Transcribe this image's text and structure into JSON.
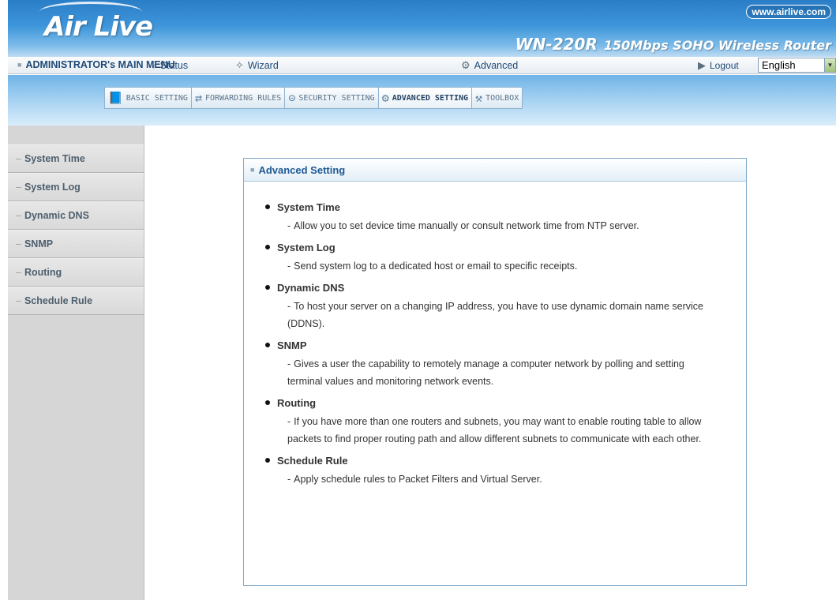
{
  "header": {
    "logo": "Air Live",
    "url": "www.airlive.com",
    "model_name": "WN-220R",
    "model_desc": "150Mbps SOHO Wireless Router"
  },
  "menubar": {
    "admin": "ADMINISTRATOR's MAIN MENU",
    "status": "Status",
    "wizard": "Wizard",
    "advanced": "Advanced",
    "logout": "Logout",
    "language": "English"
  },
  "tabs": [
    {
      "label": "BASIC SETTING",
      "icon": "book-icon"
    },
    {
      "label": "FORWARDING RULES",
      "icon": "arrows-icon"
    },
    {
      "label": "SECURITY SETTING",
      "icon": "lock-icon"
    },
    {
      "label": "ADVANCED SETTING",
      "icon": "gear-icon"
    },
    {
      "label": "TOOLBOX",
      "icon": "toolbox-icon"
    }
  ],
  "sidebar": {
    "items": [
      {
        "label": "System Time"
      },
      {
        "label": "System Log"
      },
      {
        "label": "Dynamic DNS"
      },
      {
        "label": "SNMP"
      },
      {
        "label": "Routing"
      },
      {
        "label": "Schedule Rule"
      }
    ]
  },
  "panel": {
    "title": "Advanced Setting",
    "sections": [
      {
        "title": "System Time",
        "desc": "Allow you to set device time manually or consult network time from NTP server."
      },
      {
        "title": "System Log",
        "desc": "Send system log to a dedicated host or email to specific receipts."
      },
      {
        "title": "Dynamic DNS",
        "desc": "To host your server on a changing IP address, you have to use dynamic domain name service (DDNS)."
      },
      {
        "title": "SNMP",
        "desc": "Gives a user the capability to remotely manage a computer network by polling and setting terminal values and monitoring network events."
      },
      {
        "title": "Routing",
        "desc": "If you have more than one routers and subnets, you may want to enable routing table to allow packets to find proper routing path and allow different subnets to communicate with each other."
      },
      {
        "title": "Schedule Rule",
        "desc": "Apply schedule rules to Packet Filters and Virtual Server."
      }
    ]
  },
  "colors": {
    "banner": "#3e95da",
    "sidebar": "#d6d6d6",
    "panel_border": "#7fa9c9",
    "title_text": "#1f5a94"
  }
}
